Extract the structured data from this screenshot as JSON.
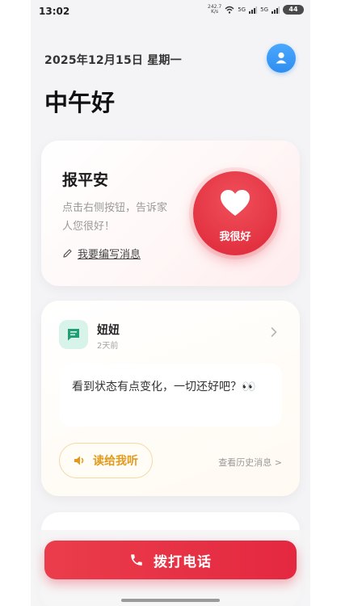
{
  "status_bar": {
    "time": "13:02",
    "net_speed_value": "242.7",
    "net_speed_unit": "K/s",
    "sim1": "5G",
    "sim2": "5G",
    "battery": "44"
  },
  "header": {
    "date": "2025年12月15日 星期一",
    "greeting": "中午好"
  },
  "safe_card": {
    "title": "报平安",
    "description": "点击右侧按钮，告诉家人您很好！",
    "edit_label": "我要编写消息",
    "ok_button_label": "我很好",
    "accent_color": "#e33342"
  },
  "message_card": {
    "sender": "妞妞",
    "time": "2天前",
    "message": "看到状态有点变化，一切还好吧？👀",
    "read_button_label": "读给我听",
    "history_link": "查看历史消息 >",
    "read_color": "#e39a1c"
  },
  "call_button": {
    "label": "拨打电话",
    "color": "#e42840"
  },
  "icons": {
    "avatar": "user-icon",
    "edit": "pencil-icon",
    "heart": "heart-icon",
    "sender": "chat-icon",
    "chevron": "chevron-right-icon",
    "speaker": "speaker-icon",
    "phone": "phone-icon"
  }
}
